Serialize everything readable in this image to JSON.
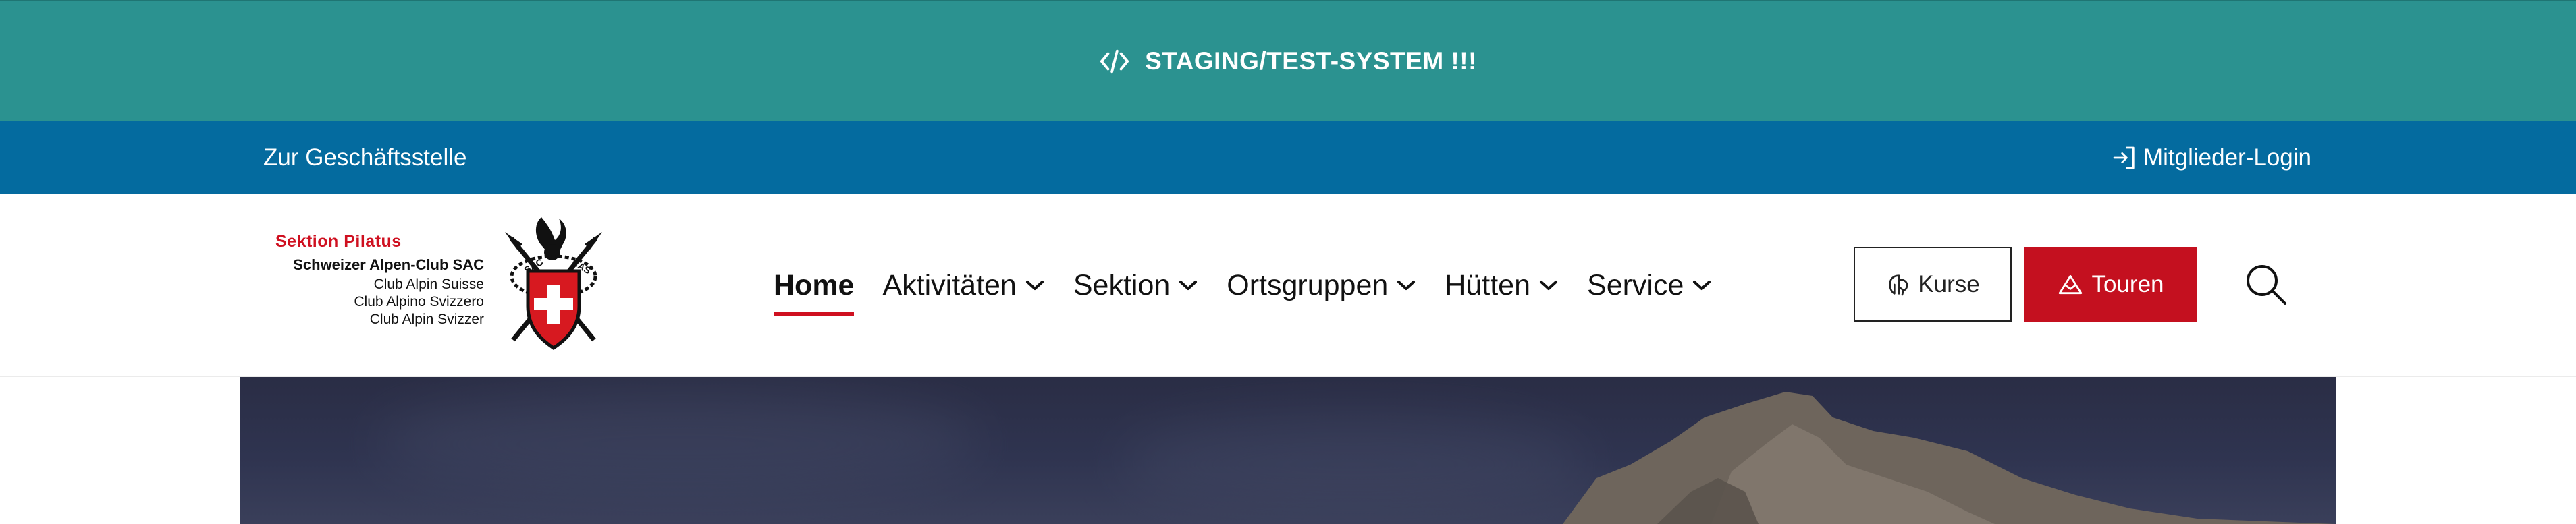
{
  "staging_banner": {
    "icon": "code-icon",
    "text": "STAGING/TEST-SYSTEM !!!",
    "color": "#2b9290"
  },
  "topbar": {
    "office_link": "Zur Geschäftsstelle",
    "login_icon": "login-icon",
    "login_label": "Mitglieder-Login",
    "color": "#046b9f"
  },
  "logo": {
    "sektion": "Sektion Pilatus",
    "club_main": "Schweizer Alpen-Club SAC",
    "club_lines": [
      "Club Alpin Suisse",
      "Club Alpino Svizzero",
      "Club Alpin Svizzer"
    ]
  },
  "nav": {
    "items": [
      {
        "label": "Home",
        "active": true,
        "dropdown": false
      },
      {
        "label": "Aktivitäten",
        "active": false,
        "dropdown": true
      },
      {
        "label": "Sektion",
        "active": false,
        "dropdown": true
      },
      {
        "label": "Ortsgruppen",
        "active": false,
        "dropdown": true
      },
      {
        "label": "Hütten",
        "active": false,
        "dropdown": true
      },
      {
        "label": "Service",
        "active": false,
        "dropdown": true
      }
    ]
  },
  "actions": {
    "kurse_label": "Kurse",
    "kurse_icon": "course-icon",
    "touren_label": "Touren",
    "touren_icon": "mountain-icon",
    "search_icon": "search-icon",
    "accent_color": "#c4101f"
  }
}
